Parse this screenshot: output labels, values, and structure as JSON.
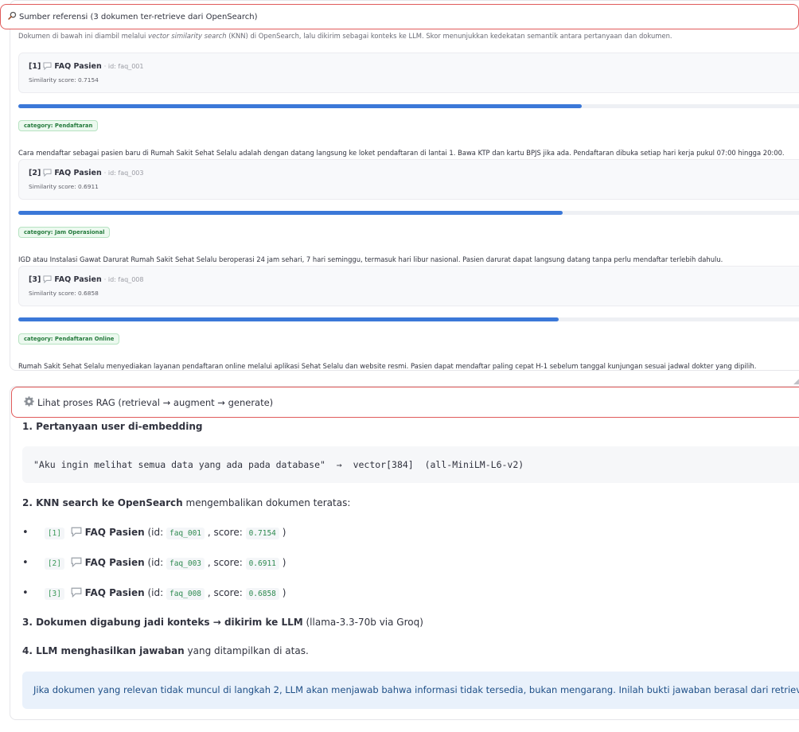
{
  "references": {
    "header": "Sumber referensi (3 dokumen ter-retrieve dari OpenSearch)",
    "intro_pre": "Dokumen di bawah ini diambil melalui ",
    "intro_em": "vector similarity search",
    "intro_post": " (KNN) di OpenSearch, lalu dikirim sebagai konteks ke LLM. Skor menunjukkan kedekatan semantik antara pertanyaan dan dokumen.",
    "docs": [
      {
        "index": "[1]",
        "title": "FAQ Pasien",
        "id_text": "· id: faq_001",
        "score_text": "Similarity score: 0.7154",
        "score": 0.7154,
        "category": "category: Pendaftaran",
        "content": "Cara mendaftar sebagai pasien baru di Rumah Sakit Sehat Selalu adalah dengan datang langsung ke loket pendaftaran di lantai 1. Bawa KTP dan kartu BPJS jika ada. Pendaftaran dibuka setiap hari kerja pukul 07:00 hingga 20:00."
      },
      {
        "index": "[2]",
        "title": "FAQ Pasien",
        "id_text": "· id: faq_003",
        "score_text": "Similarity score: 0.6911",
        "score": 0.6911,
        "category": "category: Jam Operasional",
        "content": "IGD atau Instalasi Gawat Darurat Rumah Sakit Sehat Selalu beroperasi 24 jam sehari, 7 hari seminggu, termasuk hari libur nasional. Pasien darurat dapat langsung datang tanpa perlu mendaftar terlebih dahulu."
      },
      {
        "index": "[3]",
        "title": "FAQ Pasien",
        "id_text": "· id: faq_008",
        "score_text": "Similarity score: 0.6858",
        "score": 0.6858,
        "category": "category: Pendaftaran Online",
        "content": "Rumah Sakit Sehat Selalu menyediakan layanan pendaftaran online melalui aplikasi Sehat Selalu dan website resmi. Pasien dapat mendaftar paling cepat H-1 sebelum tanggal kunjungan sesuai jadwal dokter yang dipilih."
      }
    ]
  },
  "rag": {
    "header": "Lihat proses RAG (retrieval → augment → generate)",
    "step1": "1. Pertanyaan user di-embedding",
    "code": "\"Aku ingin melihat semua data yang ada pada database\"  →  vector[384]  (all-MiniLM-L6-v2)",
    "step2_bold": "2. KNN search ke OpenSearch",
    "step2_rest": " mengembalikan dokumen teratas:",
    "results": [
      {
        "num": "[1]",
        "name": "FAQ Pasien",
        "id": "faq_001",
        "score": "0.7154"
      },
      {
        "num": "[2]",
        "name": "FAQ Pasien",
        "id": "faq_003",
        "score": "0.6911"
      },
      {
        "num": "[3]",
        "name": "FAQ Pasien",
        "id": "faq_008",
        "score": "0.6858"
      }
    ],
    "id_label": " (id: ",
    "score_label": " , score: ",
    "close_paren": " )",
    "step3_bold": "3. Dokumen digabung jadi konteks → dikirim ke LLM",
    "step3_rest": " (llama-3.3-70b via Groq)",
    "step4_bold": "4. LLM menghasilkan jawaban",
    "step4_rest": " yang ditampilkan di atas.",
    "info": "Jika dokumen yang relevan tidak muncul di langkah 2, LLM akan menjawab bahwa informasi tidak tersedia, bukan mengarang. Inilah bukti jawaban berasal dari retrieval,"
  },
  "icons": {
    "search": "magnifier-icon",
    "chat": "speech-bubble-icon",
    "gear": "gear-icon"
  },
  "colors": {
    "accent_border": "#e05a5a",
    "bar": "#3b78d8",
    "badge_text": "#247a3c",
    "info_bg": "#e9f1fb"
  }
}
